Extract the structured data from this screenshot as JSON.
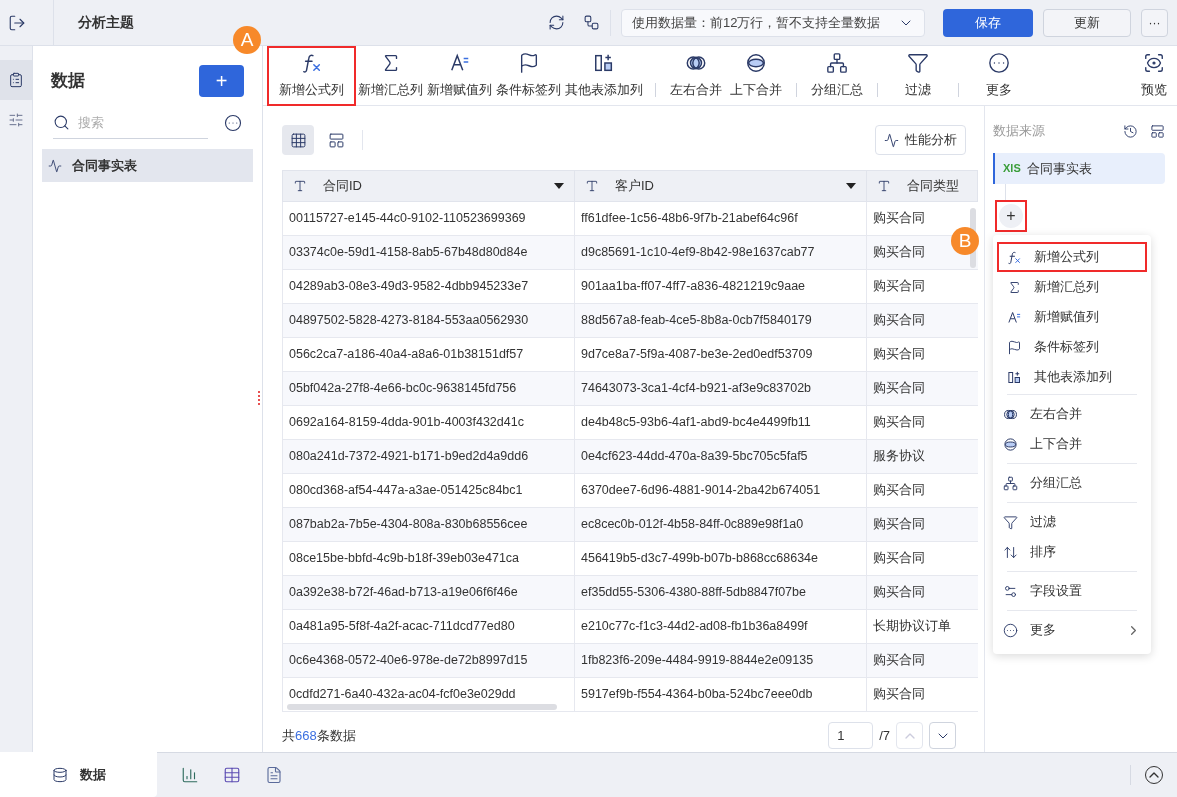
{
  "header": {
    "title": "分析主题",
    "data_scope": "使用数据量：前12万行，暂不支持全量数据",
    "save": "保存",
    "update": "更新",
    "more": "···"
  },
  "toolbar": {
    "groups": [
      [
        {
          "label": "新增公式列",
          "highlighted": true
        },
        {
          "label": "新增汇总列",
          "highlighted": false
        },
        {
          "label": "新增赋值列",
          "highlighted": false
        },
        {
          "label": "条件标签列",
          "highlighted": false
        },
        {
          "label": "其他表添加列",
          "highlighted": false
        }
      ],
      [
        {
          "label": "左右合并",
          "highlighted": false
        },
        {
          "label": "上下合并",
          "highlighted": false
        }
      ],
      [
        {
          "label": "分组汇总",
          "highlighted": false
        }
      ],
      [
        {
          "label": "过滤",
          "highlighted": false
        }
      ],
      [
        {
          "label": "更多",
          "highlighted": false
        }
      ]
    ],
    "preview": "预览"
  },
  "annotations": [
    {
      "letter": "A"
    },
    {
      "letter": "B"
    }
  ],
  "sidebar": {
    "title": "数据",
    "add": "+",
    "search": {
      "placeholder": "搜索"
    },
    "items": [
      {
        "label": "合同事实表",
        "selected": true
      }
    ]
  },
  "rail": [
    {
      "selected": true
    },
    {
      "selected": false
    }
  ],
  "view_toggle": [
    {
      "selected": true
    },
    {
      "selected": false
    }
  ],
  "performance": "性能分析",
  "table": {
    "columns": [
      {
        "label": "合同ID",
        "sortable": true
      },
      {
        "label": "客户ID",
        "sortable": true
      },
      {
        "label": "合同类型",
        "sortable": false
      }
    ],
    "rows": [
      [
        "00115727-e145-44c0-9102-110523699369",
        "ff61dfee-1c56-48b6-9f7b-21abef64c96f",
        "购买合同"
      ],
      [
        "03374c0e-59d1-4158-8ab5-67b48d80d84e",
        "d9c85691-1c10-4ef9-8b42-98e1637cab77",
        "购买合同"
      ],
      [
        "04289ab3-08e3-49d3-9582-4dbb945233e7",
        "901aa1ba-ff07-4ff7-a836-4821219c9aae",
        "购买合同"
      ],
      [
        "04897502-5828-4273-8184-553aa0562930",
        "88d567a8-feab-4ce5-8b8a-0cb7f5840179",
        "购买合同"
      ],
      [
        "056c2ca7-a186-40a4-a8a6-01b38151df57",
        "9d7ce8a7-5f9a-4087-be3e-2ed0edf53709",
        "购买合同"
      ],
      [
        "05bf042a-27f8-4e66-bc0c-9638145fd756",
        "74643073-3ca1-4cf4-b921-af3e9c83702b",
        "购买合同"
      ],
      [
        "0692a164-8159-4dda-901b-4003f432d41c",
        "de4b48c5-93b6-4af1-abd9-bc4e4499fb11",
        "购买合同"
      ],
      [
        "080a241d-7372-4921-b171-b9ed2d4a9dd6",
        "0e4cf623-44dd-470a-8a39-5bc705c5faf5",
        "服务协议"
      ],
      [
        "080cd368-af54-447a-a3ae-051425c84bc1",
        "6370dee7-6d96-4881-9014-2ba42b674051",
        "购买合同"
      ],
      [
        "087bab2a-7b5e-4304-808a-830b68556cee",
        "ec8cec0b-012f-4b58-84ff-0c889e98f1a0",
        "购买合同"
      ],
      [
        "08ce15be-bbfd-4c9b-b18f-39eb03e471ca",
        "456419b5-d3c7-499b-b07b-b868cc68634e",
        "购买合同"
      ],
      [
        "0a392e38-b72f-46ad-b713-a19e06f6f46e",
        "ef35dd55-5306-4380-88ff-5db8847f07be",
        "购买合同"
      ],
      [
        "0a481a95-5f8f-4a2f-acac-711dcd77ed80",
        "e210c77c-f1c3-44d2-ad08-fb1b36a8499f",
        "长期协议订单"
      ],
      [
        "0c6e4368-0572-40e6-978e-de72b8997d15",
        "1fb823f6-209e-4484-9919-8844e2e09135",
        "购买合同"
      ],
      [
        "0cdfd271-6a40-432a-ac04-fcf0e3e029dd",
        "5917ef9b-f554-4364-b0ba-524bc7eee0db",
        "购买合同"
      ]
    ]
  },
  "footer": {
    "total_prefix": "共",
    "total_count": "668",
    "total_suffix": "条数据",
    "page": "1",
    "page_total": "/7",
    "prev_disabled": true
  },
  "source_panel": {
    "title": "数据来源",
    "source": {
      "file_type": "XlS",
      "label": "合同事实表",
      "selected": true
    },
    "add": {
      "label": "+",
      "highlighted": true
    }
  },
  "menu": {
    "groups": [
      [
        {
          "label": "新增公式列",
          "highlighted": true
        },
        {
          "label": "新增汇总列",
          "highlighted": false
        },
        {
          "label": "新增赋值列",
          "highlighted": false
        },
        {
          "label": "条件标签列",
          "highlighted": false
        },
        {
          "label": "其他表添加列",
          "highlighted": false
        }
      ],
      [
        {
          "label": "左右合并",
          "highlighted": false
        },
        {
          "label": "上下合并",
          "highlighted": false
        }
      ],
      [
        {
          "label": "分组汇总",
          "highlighted": false
        }
      ],
      [
        {
          "label": "过滤",
          "highlighted": false
        },
        {
          "label": "排序",
          "highlighted": false
        }
      ],
      [
        {
          "label": "字段设置",
          "highlighted": false
        }
      ],
      [
        {
          "label": "更多",
          "highlighted": false,
          "submenu": true
        }
      ]
    ]
  },
  "bottom_tabs": [
    {
      "label": "数据",
      "selected": true
    }
  ]
}
